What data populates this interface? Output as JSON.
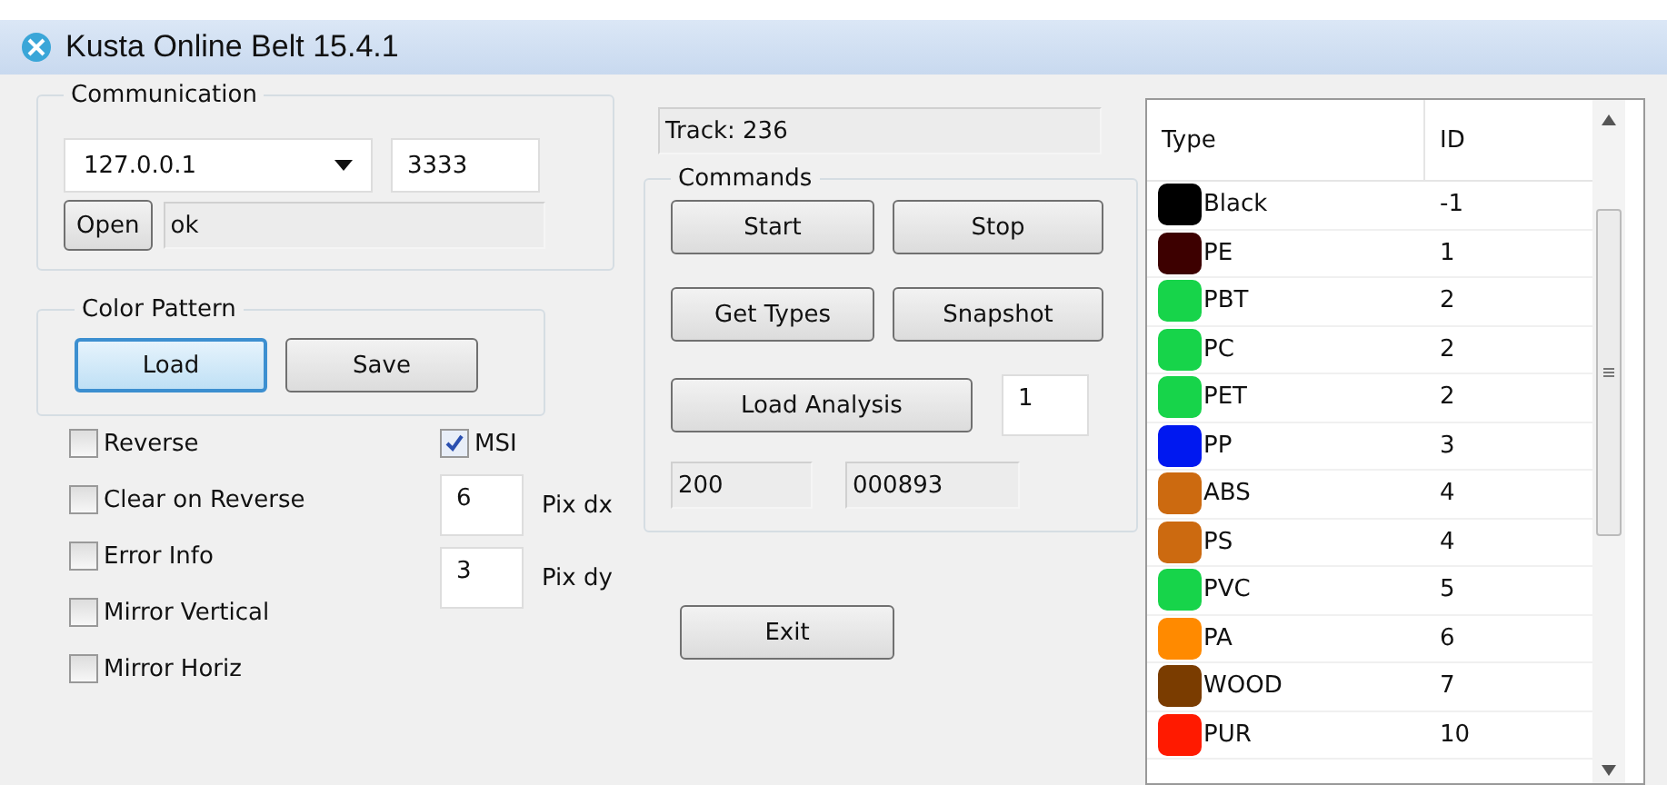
{
  "window": {
    "title": "Kusta Online Belt 15.4.1"
  },
  "communication": {
    "title": "Communication",
    "address": "127.0.0.1",
    "port": "3333",
    "open_button": "Open",
    "status": "ok"
  },
  "color_pattern": {
    "title": "Color Pattern",
    "buttons": [
      {
        "label": "Load",
        "focused": true
      },
      {
        "label": "Save",
        "focused": false
      }
    ]
  },
  "options": [
    {
      "label": "Reverse",
      "checked": false
    },
    {
      "label": "Clear on Reverse",
      "checked": false
    },
    {
      "label": "Error Info",
      "checked": false
    },
    {
      "label": "Mirror Vertical",
      "checked": false
    },
    {
      "label": "Mirror Horiz",
      "checked": false
    }
  ],
  "msi": {
    "label": "MSI",
    "checked": true
  },
  "pixel_fields": [
    {
      "value": "6",
      "label": "Pix dx"
    },
    {
      "value": "3",
      "label": "Pix dy"
    }
  ],
  "track": "Track: 236",
  "commands": {
    "title": "Commands",
    "buttons": [
      "Start",
      "Stop",
      "Get Types",
      "Snapshot"
    ],
    "load_analysis": "Load Analysis",
    "analysis_value": "1",
    "readouts": [
      "200",
      "000893"
    ]
  },
  "exit_button": "Exit",
  "types_table": {
    "columns": [
      "Type",
      "ID"
    ],
    "rows": [
      {
        "type": "Black",
        "id": "-1",
        "color": "#000000"
      },
      {
        "type": "PE",
        "id": "1",
        "color": "#3d0000"
      },
      {
        "type": "PBT",
        "id": "2",
        "color": "#17d44a"
      },
      {
        "type": "PC",
        "id": "2",
        "color": "#17d44a"
      },
      {
        "type": "PET",
        "id": "2",
        "color": "#17d44a"
      },
      {
        "type": "PP",
        "id": "3",
        "color": "#0018f0"
      },
      {
        "type": "ABS",
        "id": "4",
        "color": "#cc6a10"
      },
      {
        "type": "PS",
        "id": "4",
        "color": "#cc6a10"
      },
      {
        "type": "PVC",
        "id": "5",
        "color": "#17d44a"
      },
      {
        "type": "PA",
        "id": "6",
        "color": "#ff8a00"
      },
      {
        "type": "WOOD",
        "id": "7",
        "color": "#7a3c00"
      },
      {
        "type": "PUR",
        "id": "10",
        "color": "#ff1a00"
      }
    ]
  }
}
